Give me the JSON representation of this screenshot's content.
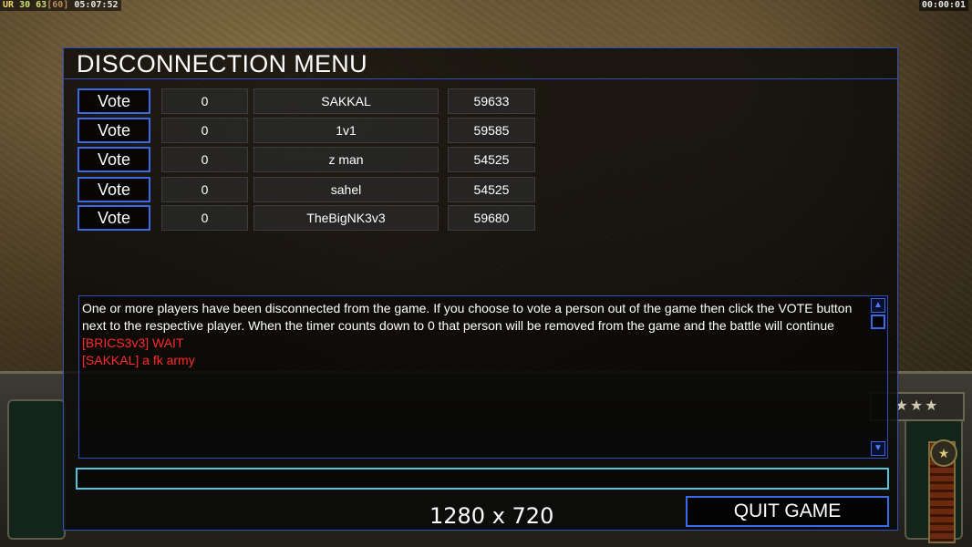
{
  "hud": {
    "ur": "UR",
    "fps": "30",
    "value": "63",
    "bracket": "[60]",
    "clock": "05:07:52",
    "timer": "00:00:01"
  },
  "dialog": {
    "title": "DISCONNECTION MENU",
    "vote_label": "Vote",
    "players": [
      {
        "votes": "0",
        "name": "SAKKAL",
        "ping": "59633"
      },
      {
        "votes": "0",
        "name": "1v1",
        "ping": "59585"
      },
      {
        "votes": "0",
        "name": "z man",
        "ping": "54525"
      },
      {
        "votes": "0",
        "name": "sahel",
        "ping": "54525"
      },
      {
        "votes": "0",
        "name": "TheBigNK3v3",
        "ping": "59680"
      }
    ],
    "message": "One or more players have been disconnected from the game. If you choose to vote a person out of the game then click the VOTE button next to the respective player. When the timer counts down to 0 that person will be removed from the game and the battle will continue",
    "chat": [
      "[BRICS3v3] WAIT",
      "[SAKKAL] a fk army"
    ],
    "chat_input_value": "",
    "quit_label": "QUIT GAME"
  },
  "overlay": {
    "resolution": "1280 x 720"
  },
  "colors": {
    "accent_blue": "#3a6ae8",
    "chat_red": "#ff2a2a",
    "input_cyan": "#58c4d8"
  }
}
